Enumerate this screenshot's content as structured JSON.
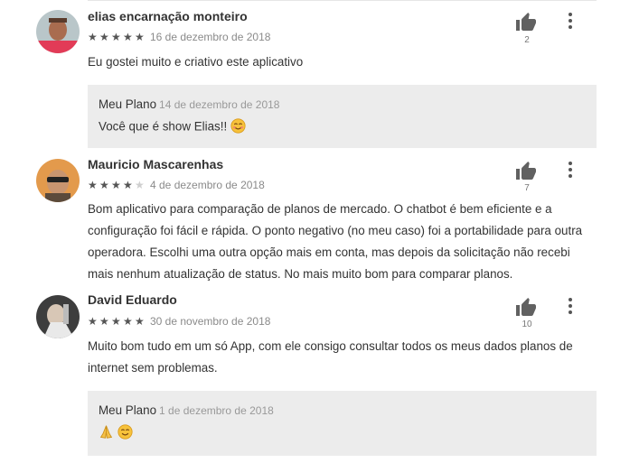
{
  "reviews": [
    {
      "author": "elias encarnação monteiro",
      "rating": 5,
      "date": "16 de dezembro de 2018",
      "text": "Eu gostei muito e criativo este aplicativo",
      "likes": "2",
      "reply": {
        "developer": "Meu Plano",
        "date": "14 de dezembro de 2018",
        "text": "Você que é show Elias!!",
        "emoji": "blush-face-emoji"
      }
    },
    {
      "author": "Mauricio Mascarenhas",
      "rating": 4,
      "date": "4 de dezembro de 2018",
      "text_lines": [
        "Bom aplicativo para comparação de planos de mercado. O chatbot é bem eficiente e a",
        "configuração foi fácil e rápida. O ponto negativo (no meu caso) foi a portabilidade para outra",
        "operadora. Escolhi uma outra opção mais em conta, mas depois da solicitação não recebi",
        "mais nenhum atualização de status. No mais muito bom para comparar planos."
      ],
      "likes": "7"
    },
    {
      "author": "David Eduardo",
      "rating": 5,
      "date": "30 de novembro de 2018",
      "text_lines": [
        "Muito bom tudo em um só App, com ele consigo consultar todos os meus dados planos de",
        "internet sem problemas."
      ],
      "likes": "10",
      "reply": {
        "developer": "Meu Plano",
        "date": "1 de dezembro de 2018",
        "text": "",
        "emoji": "praying-hands-and-smile-emoji"
      }
    }
  ],
  "icons": {
    "like": "thumbs-up-icon",
    "menu": "more-vert-icon",
    "star": "star-icon"
  }
}
